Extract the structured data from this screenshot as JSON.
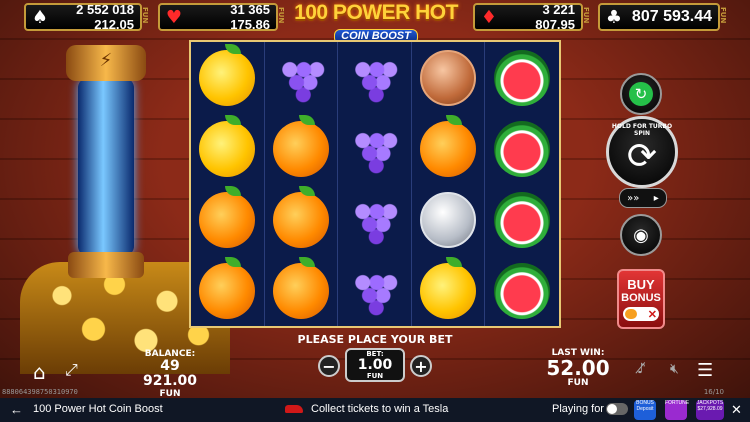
{
  "jackpots": [
    {
      "suit": "♠",
      "value": "2 552 018 212.05",
      "currency": "FUN"
    },
    {
      "suit": "♥",
      "value": "31 365 175.86",
      "currency": "FUN"
    },
    {
      "suit": "♦",
      "value": "3 221 807.95",
      "currency": "FUN"
    },
    {
      "suit": "♣",
      "value": "807 593.44",
      "currency": "FUN"
    }
  ],
  "logo": {
    "line1": "100 POWER HOT",
    "line2": "COIN BOOST"
  },
  "reels": [
    [
      "lemon",
      "lemon",
      "orange",
      "orange"
    ],
    [
      "grapes",
      "orange",
      "orange",
      "orange"
    ],
    [
      "grapes",
      "grapes",
      "grapes",
      "grapes"
    ],
    [
      "copper-coin",
      "orange",
      "silver-coin",
      "lemon"
    ],
    [
      "watermelon",
      "watermelon",
      "watermelon",
      "watermelon"
    ]
  ],
  "controls": {
    "turbo_label": "HOLD FOR TURBO SPIN",
    "buy_bonus_line1": "BUY",
    "buy_bonus_line2": "BONUS"
  },
  "status_message": "PLEASE PLACE YOUR BET",
  "balance": {
    "label": "BALANCE:",
    "value": "49 921.00",
    "currency": "FUN"
  },
  "bet": {
    "label": "BET:",
    "value": "1.00",
    "currency": "FUN"
  },
  "last_win": {
    "label": "LAST WIN:",
    "value": "52.00",
    "currency": "FUN"
  },
  "session_id": "888064398750310970",
  "counter": "16/10",
  "browser_bar": {
    "title": "100 Power Hot Coin Boost",
    "promo": "Collect tickets to win a Tesla",
    "play_for_real": "Playing for real",
    "badges": [
      {
        "name": "BONUS Deposit",
        "amount": ""
      },
      {
        "name": "FORTUNE",
        "amount": ""
      },
      {
        "name": "JACKPOTS",
        "amount": "$27,928.09"
      }
    ]
  },
  "colors": {
    "accent_gold": "#e8c873",
    "reel_bg": "#0b1b4a",
    "buy_red": "#d01818",
    "autoplay_green": "#25c049"
  }
}
